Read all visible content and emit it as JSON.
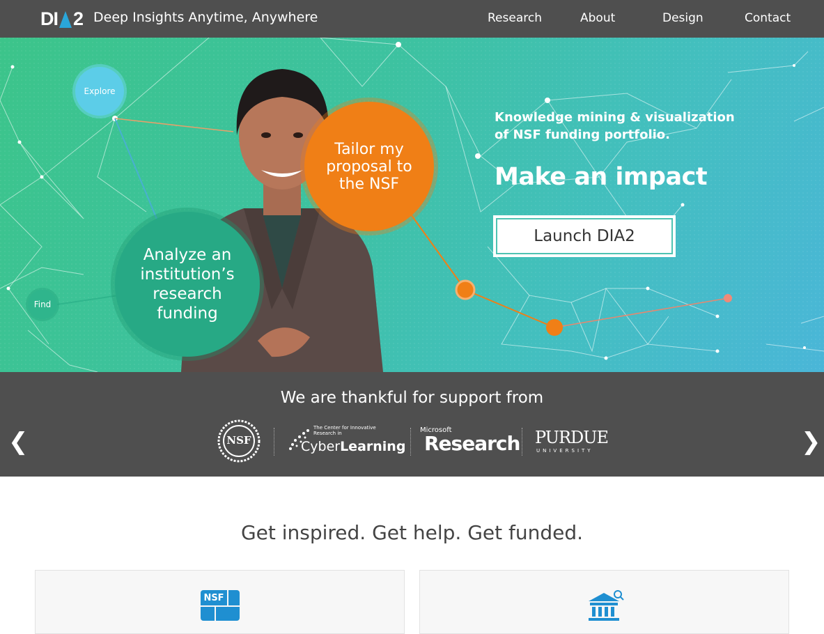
{
  "header": {
    "logo_left": "DI",
    "logo_right": "2",
    "tagline": "Deep Insights Anytime, Anywhere",
    "nav": [
      "Research",
      "About",
      "Design",
      "Contact"
    ]
  },
  "hero": {
    "subtitle": "Knowledge mining & visualization of NSF funding portfolio.",
    "title": "Make an impact",
    "launch_label": "Launch DIA2",
    "bubbles": {
      "orange": "Tailor my proposal to the NSF",
      "green": "Analyze an institution’s research funding",
      "explore": "Explore",
      "find": "Find"
    }
  },
  "support": {
    "title": "We are thankful for support from",
    "prev": "❮",
    "next": "❯",
    "sponsors": {
      "nsf": "NSF",
      "cyber_small": "The Center for Innovative Research in",
      "cyber_a": "Cyber",
      "cyber_b": "Learning",
      "ms_small": "Microsoft",
      "ms_big": "Research",
      "purdue_big": "PURDUE",
      "purdue_small": "UNIVERSITY"
    }
  },
  "section": {
    "heading": "Get inspired. Get help. Get funded.",
    "card_left_icon": "NSF"
  },
  "colors": {
    "topbar": "#4f4f4f",
    "orange": "#f07f16",
    "green": "#27a985",
    "accent_blue": "#2aa6d9"
  }
}
